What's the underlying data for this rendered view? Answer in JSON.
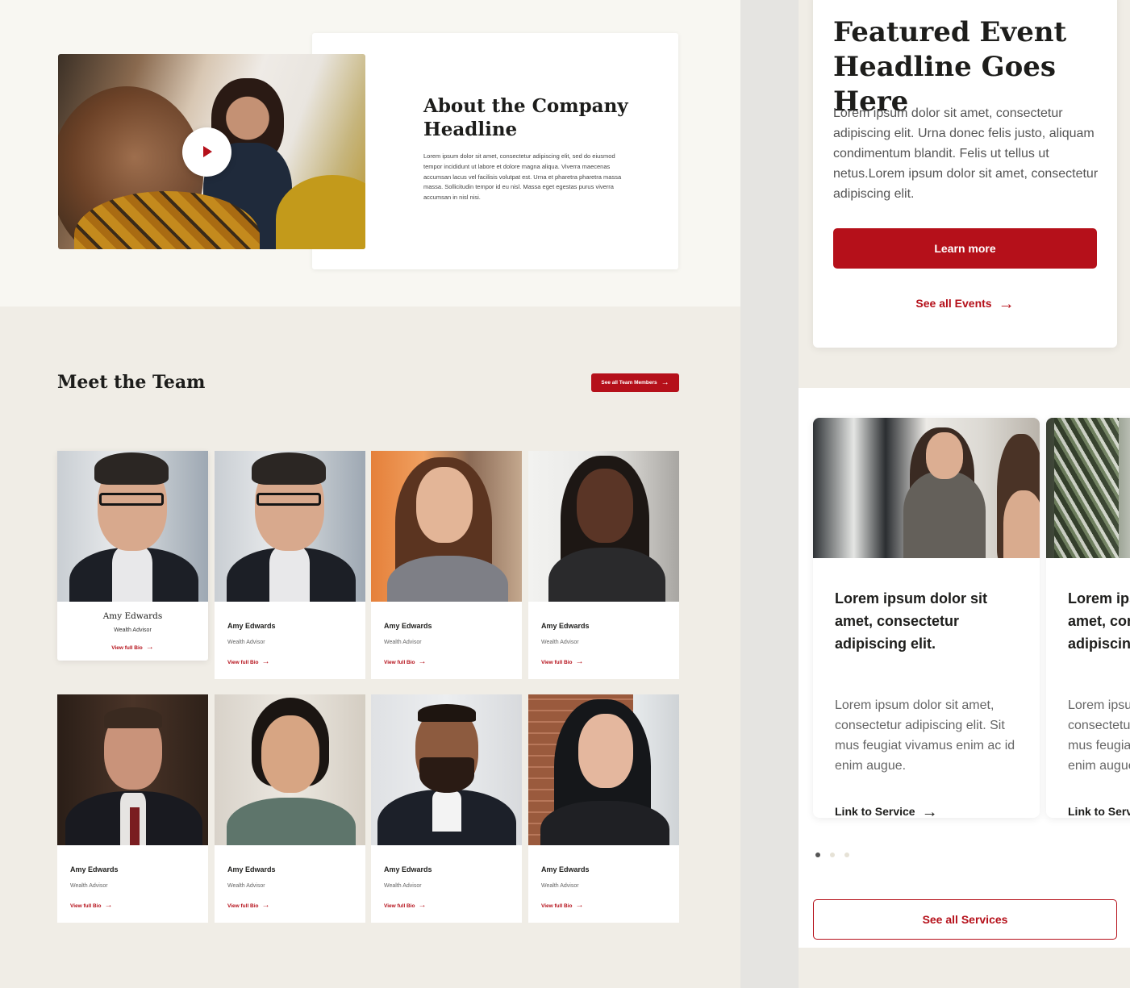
{
  "about": {
    "title": "About the Company Headline",
    "text": "Lorem ipsum dolor sit amet, consectetur adipiscing elit, sed do eiusmod tempor incididunt ut labore et dolore magna aliqua. Viverra maecenas accumsan lacus vel facilisis volutpat est. Urna et pharetra pharetra massa massa. Sollicitudin tempor id eu nisl. Massa eget egestas purus viverra accumsan in nisl nisi.",
    "play_icon": "play-icon"
  },
  "team": {
    "title": "Meet the Team",
    "see_all_label": "See all Team Members",
    "members": [
      {
        "name": "Amy Edwards",
        "role": "Wealth Advisor",
        "bio_label": "View full Bio"
      },
      {
        "name": "Amy Edwards",
        "role": "Wealth Advisor",
        "bio_label": "View full Bio"
      },
      {
        "name": "Amy Edwards",
        "role": "Wealth Advisor",
        "bio_label": "View full Bio"
      },
      {
        "name": "Amy Edwards",
        "role": "Wealth Advisor",
        "bio_label": "View full Bio"
      },
      {
        "name": "Amy Edwards",
        "role": "Wealth Advisor",
        "bio_label": "View full Bio"
      },
      {
        "name": "Amy Edwards",
        "role": "Wealth Advisor",
        "bio_label": "View full Bio"
      },
      {
        "name": "Amy Edwards",
        "role": "Wealth Advisor",
        "bio_label": "View full Bio"
      },
      {
        "name": "Amy Edwards",
        "role": "Wealth Advisor",
        "bio_label": "View full Bio"
      }
    ]
  },
  "event": {
    "title": "Featured Event Headline Goes Here",
    "text": "Lorem ipsum dolor sit amet, consectetur adipiscing elit. Urna donec felis justo, aliquam condimentum blandit. Felis ut tellus ut netus.Lorem ipsum dolor sit amet, consectetur adipiscing elit.",
    "learn_more_label": "Learn more",
    "see_all_label": "See all Events"
  },
  "services": {
    "cards": [
      {
        "title": "Lorem ipsum dolor sit amet, consectetur adipiscing elit.",
        "text": "Lorem ipsum dolor sit amet, consectetur adipiscing elit. Sit mus feugiat vivamus enim ac id enim augue.",
        "link_label": "Link to Service"
      },
      {
        "title": "Lorem ipsum dolor sit amet, consectetur adipiscing elit.",
        "text": "Lorem ipsum dolor sit amet, consectetur adipiscing elit. Sit mus feugiat vivamus enim ac id enim augue.",
        "link_label": "Link to Service"
      }
    ],
    "active_slide": 1,
    "slide_count": 3,
    "see_all_label": "See all Services"
  },
  "colors": {
    "accent": "#b5101a",
    "page_bg": "#f0ede6",
    "about_bg": "#f8f7f2"
  }
}
